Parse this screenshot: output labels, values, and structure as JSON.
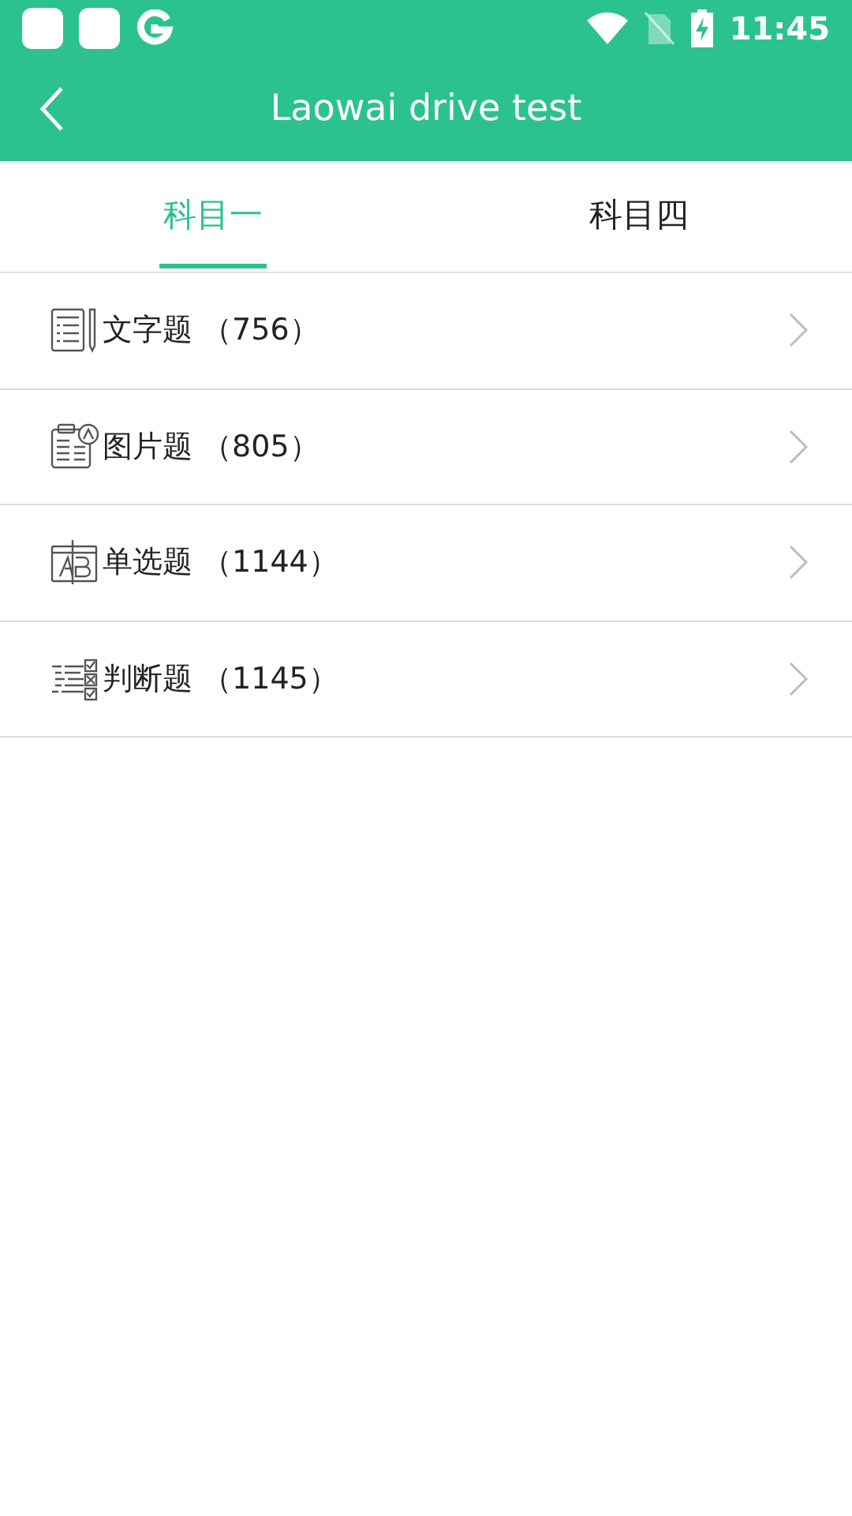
{
  "status_bar": {
    "time": "11:45"
  },
  "header": {
    "title": "Laowai drive test"
  },
  "tabs": [
    {
      "label": "科目一",
      "selected": true
    },
    {
      "label": "科目四",
      "selected": false
    }
  ],
  "items": [
    {
      "kind": "text",
      "label": "文字题 （756）"
    },
    {
      "kind": "image",
      "label": "图片题 （805）"
    },
    {
      "kind": "choice",
      "label": "单选题 （1144）"
    },
    {
      "kind": "judge",
      "label": "判断题 （1145）"
    }
  ]
}
